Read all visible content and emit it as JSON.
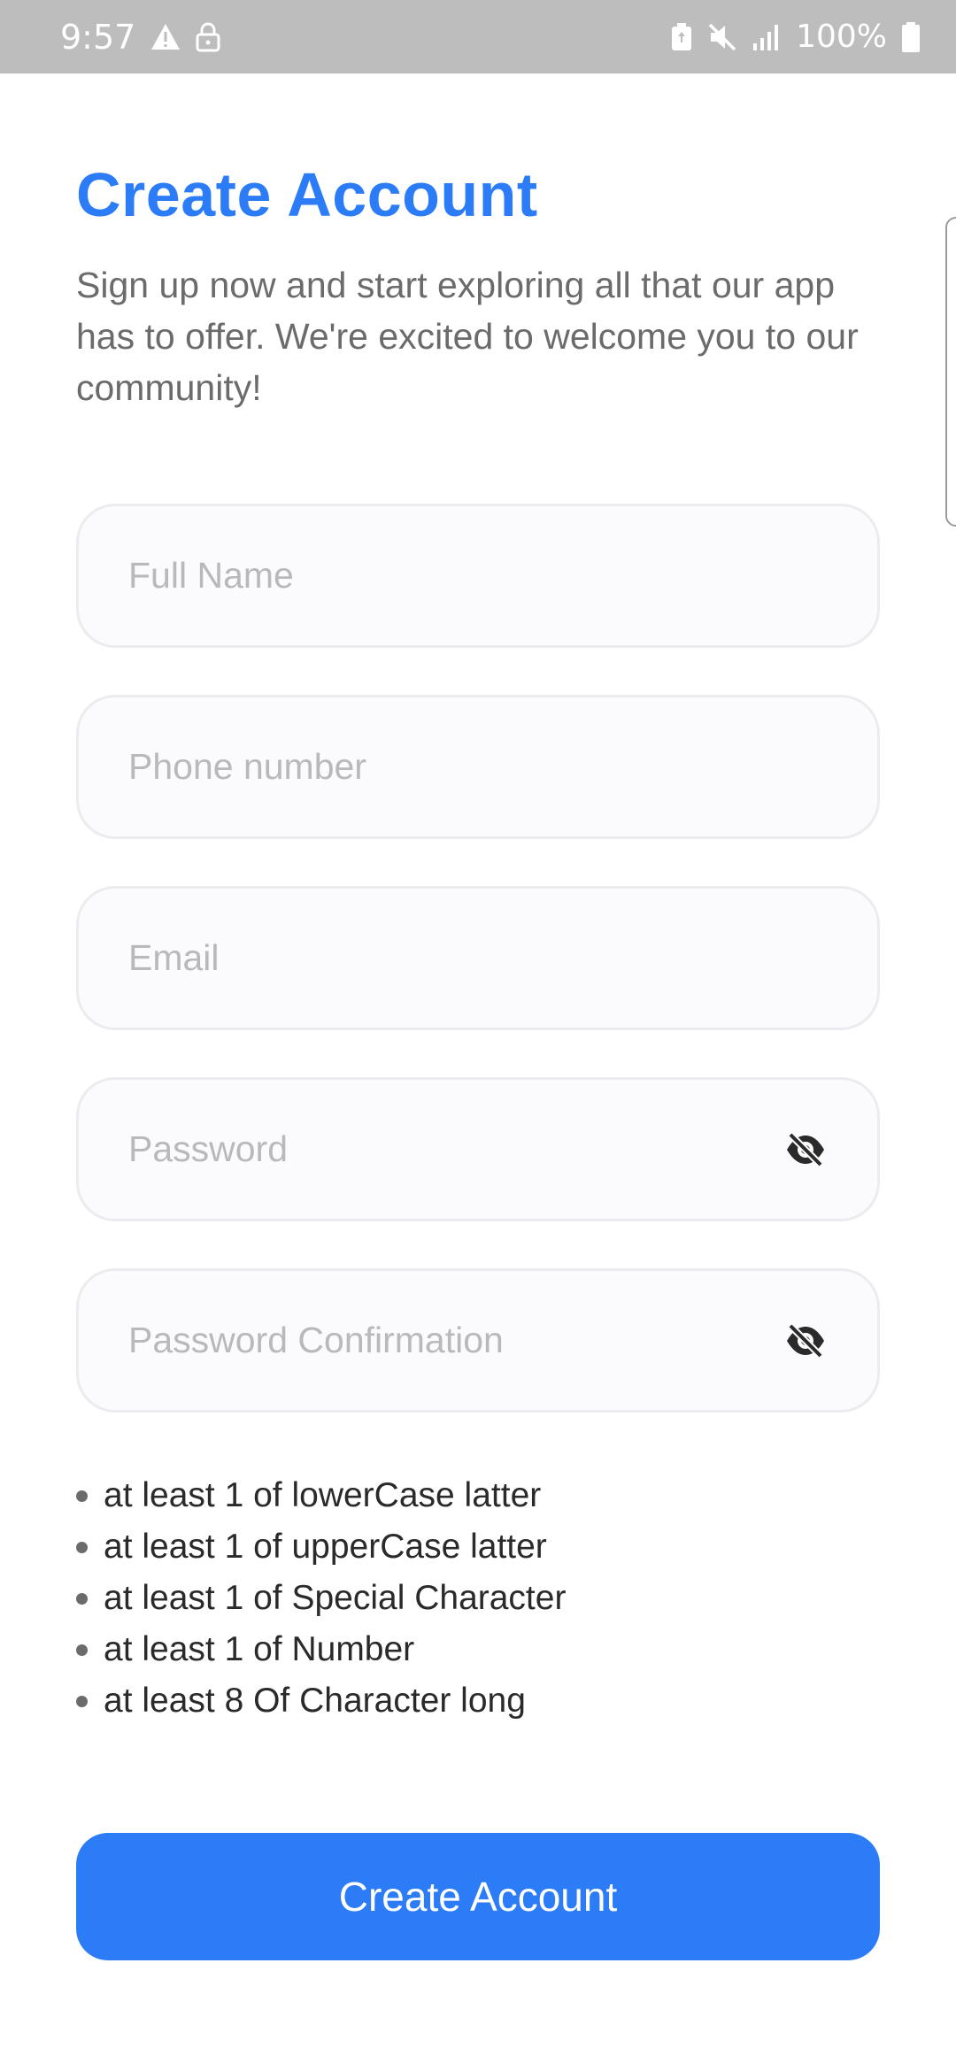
{
  "status_bar": {
    "time": "9:57",
    "battery_percent": "100%",
    "icons_left": [
      "warning-icon",
      "lock-icon"
    ],
    "icons_right": [
      "battery-saver-icon",
      "mute-icon",
      "signal-icon",
      "battery-icon"
    ]
  },
  "header": {
    "title": "Create Account",
    "subtitle": "Sign up now and start exploring all that our app has to offer. We're excited to welcome you to our community!"
  },
  "form": {
    "full_name": {
      "placeholder": "Full Name",
      "value": ""
    },
    "phone": {
      "placeholder": "Phone number",
      "value": ""
    },
    "email": {
      "placeholder": "Email",
      "value": ""
    },
    "password": {
      "placeholder": "Password",
      "value": "",
      "toggle_icon": "eye-off-icon"
    },
    "password_confirmation": {
      "placeholder": "Password Confirmation",
      "value": "",
      "toggle_icon": "eye-off-icon"
    }
  },
  "password_rules": [
    "at least 1 of lowerCase latter",
    "at least 1 of upperCase latter",
    "at least 1 of Special Character",
    "at least 1 of Number",
    "at least 8 Of Character long"
  ],
  "actions": {
    "create_account_label": "Create Account"
  },
  "colors": {
    "accent": "#2b7cf6",
    "status_bar_bg": "#bdbdbd",
    "subtitle_text": "#6b6b6b",
    "placeholder_text": "#b9b9bd",
    "field_border": "#ececf0"
  }
}
